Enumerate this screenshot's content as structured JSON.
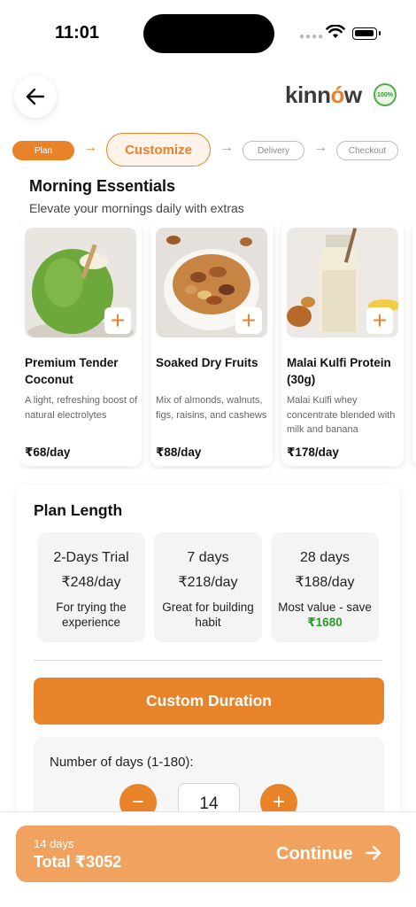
{
  "status_bar": {
    "time": "11:01"
  },
  "header": {
    "brand": "kinnow",
    "brand_pre": "kinn",
    "brand_o": "ó",
    "brand_post": "w",
    "badge_text": "100%"
  },
  "stepper": {
    "steps": [
      {
        "label": "Plan",
        "state": "done"
      },
      {
        "label": "Customize",
        "state": "active"
      },
      {
        "label": "Delivery",
        "state": "upcoming"
      },
      {
        "label": "Checkout",
        "state": "upcoming"
      }
    ]
  },
  "essentials": {
    "title": "Morning Essentials",
    "subtitle": "Elevate your mornings daily with extras",
    "items": [
      {
        "name": "Premium Tender Coconut",
        "desc": "A light, refreshing boost of natural electrolytes",
        "price": "₹68/day",
        "image": "coconut"
      },
      {
        "name": "Soaked Dry Fruits",
        "desc": "Mix of almonds, walnuts, figs, raisins, and cashews",
        "price": "₹88/day",
        "image": "dry-fruits-bowl"
      },
      {
        "name": "Malai Kulfi Protein (30g)",
        "desc": "Malai Kulfi whey concentrate blended with milk and banana",
        "price": "₹178/day",
        "image": "protein-shake-bottle"
      }
    ]
  },
  "plan_length": {
    "title": "Plan Length",
    "options": [
      {
        "name": "2-Days Trial",
        "price": "₹248/day",
        "note": "For trying the experience"
      },
      {
        "name": "7 days",
        "price": "₹218/day",
        "note": "Great for building habit"
      },
      {
        "name": "28 days",
        "price": "₹188/day",
        "note_prefix": "Most value - save",
        "note_highlight": "₹1680"
      }
    ],
    "custom_button": "Custom Duration",
    "days_label": "Number of days (1-180):",
    "days_value": "14"
  },
  "summary": {
    "days": "14 days",
    "total": "Total ₹3052",
    "continue_label": "Continue"
  },
  "colors": {
    "accent": "#e8832a",
    "accent_light": "#f0a25e",
    "savings_green": "#2a9a2a"
  }
}
